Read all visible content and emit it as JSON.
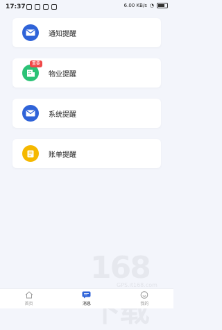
{
  "status_bar": {
    "time": "17:37",
    "network": "6.00 KB/s",
    "battery": "88"
  },
  "items": [
    {
      "label": "通知提醒",
      "icon": "envelope-icon",
      "color": "#2f63d8"
    },
    {
      "label": "物业提醒",
      "icon": "building-icon",
      "color": "#2bc276",
      "badge": "重要"
    },
    {
      "label": "系统提醒",
      "icon": "envelope-icon",
      "color": "#2f63d8"
    },
    {
      "label": "账单提醒",
      "icon": "bill-icon",
      "color": "#f5b800"
    }
  ],
  "tabs": [
    {
      "label": "首页",
      "icon": "home-icon",
      "active": false
    },
    {
      "label": "消息",
      "icon": "message-icon",
      "active": true
    },
    {
      "label": "我的",
      "icon": "profile-icon",
      "active": false
    }
  ],
  "watermark": {
    "logo": "168下载",
    "site": "GPS.it168.com"
  }
}
